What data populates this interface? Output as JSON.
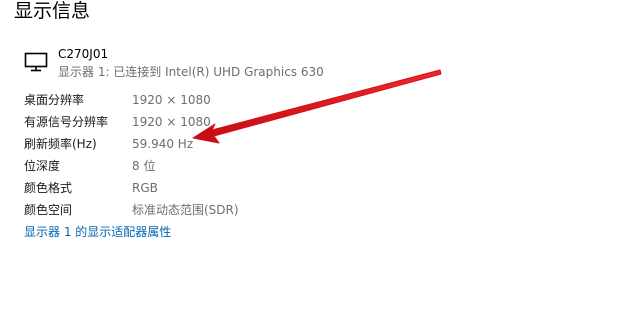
{
  "page": {
    "title": "显示信息"
  },
  "monitor": {
    "icon": "monitor-icon",
    "name": "C270J01",
    "connection": "显示器 1: 已连接到 Intel(R) UHD Graphics 630"
  },
  "properties": [
    {
      "label": "桌面分辨率",
      "value": "1920 × 1080"
    },
    {
      "label": "有源信号分辨率",
      "value": "1920 × 1080"
    },
    {
      "label": "刷新频率(Hz)",
      "value": "59.940 Hz"
    },
    {
      "label": "位深度",
      "value": "8 位"
    },
    {
      "label": "颜色格式",
      "value": "RGB"
    },
    {
      "label": "颜色空间",
      "value": "标准动态范围(SDR)"
    }
  ],
  "adapter_link": "显示器 1 的显示适配器属性",
  "annotation": {
    "icon": "red-arrow-icon",
    "color": "#e8141b"
  }
}
